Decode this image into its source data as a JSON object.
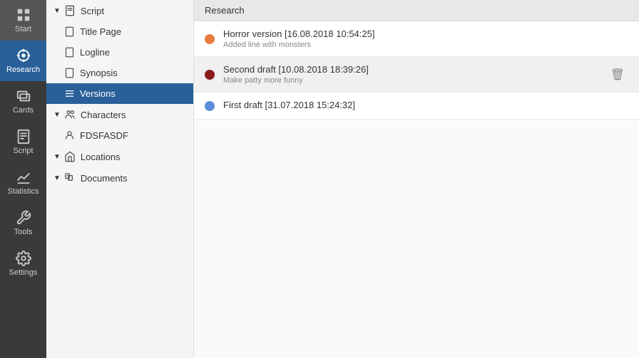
{
  "iconSidebar": {
    "items": [
      {
        "id": "start",
        "label": "Start",
        "icon": "grid"
      },
      {
        "id": "research",
        "label": "Research",
        "icon": "chart-network",
        "active": true
      },
      {
        "id": "cards",
        "label": "Cards",
        "icon": "cards"
      },
      {
        "id": "script",
        "label": "Script",
        "icon": "script"
      },
      {
        "id": "statistics",
        "label": "Statistics",
        "icon": "stats"
      },
      {
        "id": "tools",
        "label": "Tools",
        "icon": "tools"
      },
      {
        "id": "settings",
        "label": "Settings",
        "icon": "settings"
      }
    ]
  },
  "treeSidebar": {
    "header": "Research",
    "sections": [
      {
        "id": "script",
        "label": "Script",
        "icon": "script",
        "collapsed": false,
        "children": [
          {
            "id": "title-page",
            "label": "Title Page",
            "icon": "page"
          },
          {
            "id": "logline",
            "label": "Logline",
            "icon": "page"
          },
          {
            "id": "synopsis",
            "label": "Synopsis",
            "icon": "page"
          },
          {
            "id": "versions",
            "label": "Versions",
            "icon": "list",
            "active": true
          }
        ]
      },
      {
        "id": "characters",
        "label": "Characters",
        "icon": "people",
        "collapsed": false,
        "children": [
          {
            "id": "fdsfasdf",
            "label": "FDSFASDF",
            "icon": "person"
          }
        ]
      },
      {
        "id": "locations",
        "label": "Locations",
        "icon": "location",
        "collapsed": false,
        "children": []
      },
      {
        "id": "documents",
        "label": "Documents",
        "icon": "documents",
        "collapsed": false,
        "children": []
      }
    ]
  },
  "mainPanel": {
    "header": "Research",
    "versions": [
      {
        "id": "v1",
        "title": "Horror version [16.08.2018 10:54:25]",
        "subtitle": "Added line with monsters",
        "dotColor": "#e87c3e"
      },
      {
        "id": "v2",
        "title": "Second draft [10.08.2018 18:39:26]",
        "subtitle": "Make patty more funny",
        "dotColor": "#8b1a1a",
        "highlighted": true
      },
      {
        "id": "v3",
        "title": "First draft [31.07.2018 15:24:32]",
        "subtitle": "",
        "dotColor": "#5b8dd9"
      }
    ]
  }
}
